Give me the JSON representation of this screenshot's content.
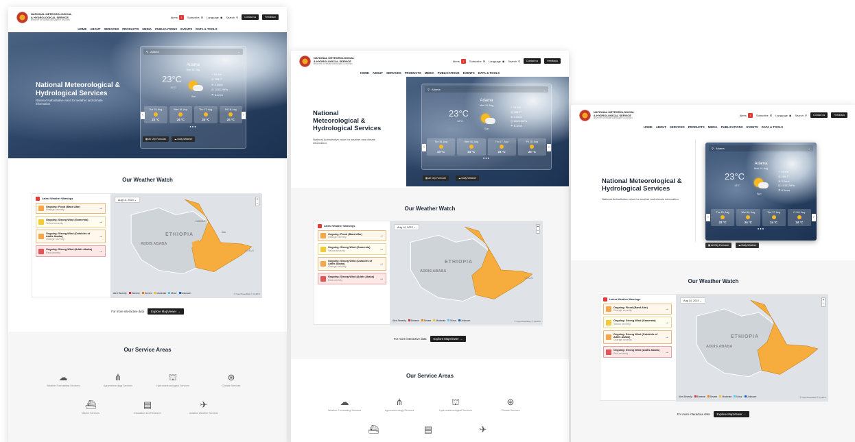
{
  "site": {
    "logo_line1": "NATIONAL METEOROLOGICAL",
    "logo_line2": "& HYDROLOGICAL SERVICE",
    "logo_tagline": "MINISTRY OF WATER AND ENERGY ETHIOPIA",
    "alerts_label": "Alerts",
    "subscribe_label": "Subscribe",
    "language_label": "Language",
    "search_label": "Search",
    "contact_label": "Contact us",
    "feedback_label": "Feedback"
  },
  "nav": [
    "HOME",
    "ABOUT",
    "SERVICES",
    "PRODUCTS",
    "MEDIA",
    "PUBLICATIONS",
    "EVENTS",
    "DATA & TOOLS"
  ],
  "hero": {
    "title_line1": "National Meteorological &",
    "title_line2": "Hydrological Services",
    "title_alt_1": "National",
    "title_alt_2": "Meteorological &",
    "title_alt_3": "Hydrological Services",
    "subtitle": "National Authoritative voice for weather and climate information",
    "all_city_btn": "All City Forecast",
    "daily_btn": "Daily Weather"
  },
  "weather": {
    "city_select": "Adama",
    "city": "Adama",
    "date": "Mon 14, Aug",
    "temp": "23°C",
    "feels": "18°C",
    "condition": "Sun",
    "stats": [
      "74.1%",
      "265.7°",
      "3.2m/s",
      "1013.2hPa",
      "6.1mm"
    ],
    "forecast": [
      {
        "day": "Tue 15, Aug",
        "temp": "23 °C"
      },
      {
        "day": "Wed 16, Aug",
        "temp": "24 °C"
      },
      {
        "day": "Thu 17, Aug",
        "temp": "24 °C"
      },
      {
        "day": "Fri 18, Aug",
        "temp": "24 °C"
      }
    ]
  },
  "watch": {
    "title": "Our Weather Watch",
    "warnings_title": "Latest Weather Warnings",
    "date": "Aug 14, 2023",
    "map_label": "ETHIOPIA",
    "city_label": "ADDIS ABABA",
    "region_label": "Afar",
    "somalia_label": "SOMAI",
    "djibouti_label": "DJIBOUTI",
    "warnings": [
      {
        "title": "Ongoing: Flood (Band Afar)",
        "severity": "Orange severity",
        "level": "orange"
      },
      {
        "title": "Ongoing: Strong Wind (Gamernia)",
        "severity": "Yellow severity",
        "level": "yellow"
      },
      {
        "title": "Ongoing: Strong Wind (Outskirts of Addis Ababa)",
        "severity": "Orange severity",
        "level": "orange"
      },
      {
        "title": "Ongoing: Strong Wind (Addis Ababa)",
        "severity": "Red severity",
        "level": "red"
      }
    ],
    "legend_title": "Alert Severity",
    "legend": [
      {
        "label": "Extreme",
        "color": "#d32f2f"
      },
      {
        "label": "Severe",
        "color": "#f57c00"
      },
      {
        "label": "Moderate",
        "color": "#fbc02d"
      },
      {
        "label": "Minor",
        "color": "#4fc3f7"
      },
      {
        "label": "Unknown",
        "color": "#1565c0"
      }
    ],
    "attribution": "© OpenStreetMap © CARTO",
    "cta_text": "For more interactive data",
    "cta_button": "Explore MapViewer"
  },
  "services": {
    "title": "Our Service Areas",
    "items": [
      {
        "label": "Weather Forecasting Services",
        "icon": "cloud-rain-icon",
        "glyph": "☁"
      },
      {
        "label": "Agrometeorology Services",
        "icon": "wheat-icon",
        "glyph": "⋔"
      },
      {
        "label": "Hydrometeorological Services",
        "icon": "dam-icon",
        "glyph": "⛫"
      },
      {
        "label": "Climate Services",
        "icon": "satellite-dish-icon",
        "glyph": "⊛"
      },
      {
        "label": "Marine Services",
        "icon": "ship-icon",
        "glyph": "⛴"
      },
      {
        "label": "Education and Research",
        "icon": "book-icon",
        "glyph": "▤"
      },
      {
        "label": "Aviation Weather Services",
        "icon": "airplane-icon",
        "glyph": "✈"
      }
    ]
  }
}
